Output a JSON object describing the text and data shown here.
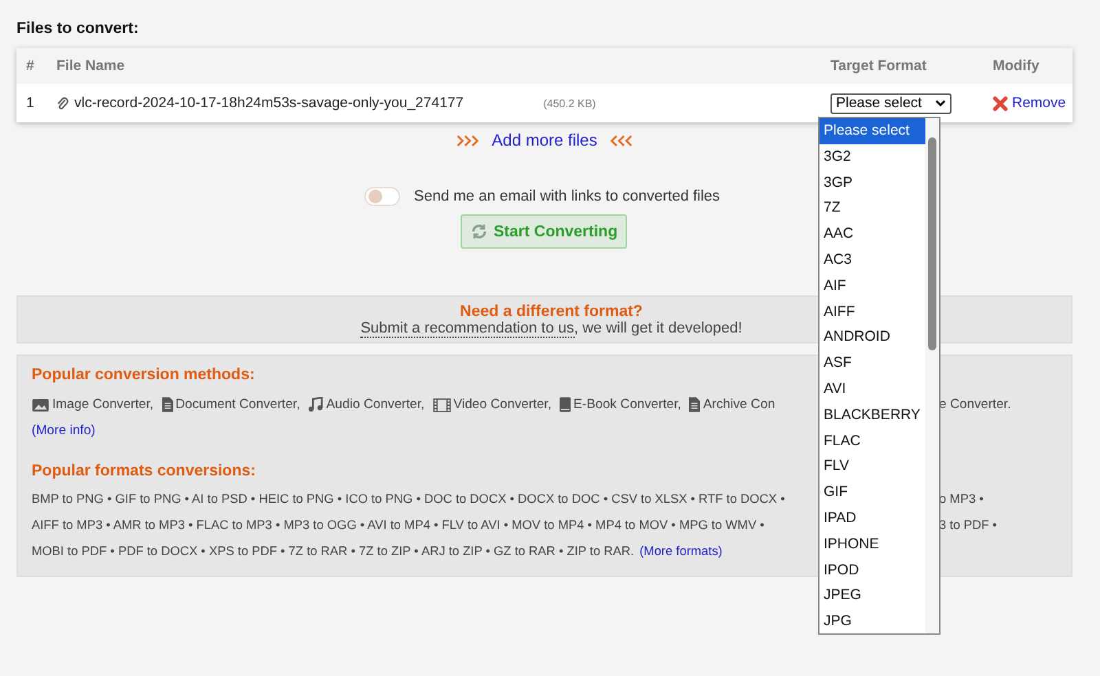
{
  "heading": "Files to convert:",
  "table": {
    "columns": [
      "#",
      "File Name",
      "Target Format",
      "Modify"
    ],
    "rows": [
      {
        "index": "1",
        "file_name": "vlc-record-2024-10-17-18h24m53s-savage-only-you_274177",
        "size": "(450.2 KB)",
        "target": "Please select",
        "remove": "Remove"
      }
    ]
  },
  "add_more": "Add more files",
  "email_toggle": {
    "on": false,
    "label": "Send me an email with links to converted files"
  },
  "convert_button": "Start Converting",
  "different_format": {
    "title": "Need a different format?",
    "link": "Submit a recommendation to us",
    "rest": ", we will get it developed!"
  },
  "methods": {
    "title": "Popular conversion methods:",
    "items": [
      {
        "kind": "image",
        "label": "Image Converter,"
      },
      {
        "kind": "document",
        "label": "Document Converter,"
      },
      {
        "kind": "audio",
        "label": "Audio Converter,"
      },
      {
        "kind": "video",
        "label": "Video Converter,"
      },
      {
        "kind": "ebook",
        "label": "E-Book Converter,"
      },
      {
        "kind": "document",
        "label": "Archive Con"
      }
    ],
    "after_dropdown": "e Converter.",
    "more": "(More info)"
  },
  "formats": {
    "title": "Popular formats conversions:",
    "lines": [
      {
        "left": "BMP to PNG • GIF to PNG • AI to PSD • HEIC to PNG • ICO to PNG • DOC to DOCX • DOCX to DOC • CSV to XLSX • RTF to DOCX •",
        "right": "o MP3 •"
      },
      {
        "left": "AIFF to MP3 • AMR to MP3 • FLAC to MP3 • MP3 to OGG • AVI to MP4 • FLV to AVI • MOV to MP4 • MP4 to MOV • MPG to WMV •",
        "right": "3 to PDF •"
      },
      {
        "left": "MOBI to PDF • PDF to DOCX • XPS to PDF • 7Z to RAR • 7Z to ZIP • ARJ to ZIP • GZ to RAR • ZIP to RAR.",
        "link": "(More formats)"
      }
    ]
  },
  "dropdown": {
    "options": [
      {
        "label": "Please select",
        "selected": true
      },
      {
        "label": "3G2",
        "selected": false
      },
      {
        "label": "3GP",
        "selected": false
      },
      {
        "label": "7Z",
        "selected": false
      },
      {
        "label": "AAC",
        "selected": false
      },
      {
        "label": "AC3",
        "selected": false
      },
      {
        "label": "AIF",
        "selected": false
      },
      {
        "label": "AIFF",
        "selected": false
      },
      {
        "label": "ANDROID",
        "selected": false
      },
      {
        "label": "ASF",
        "selected": false
      },
      {
        "label": "AVI",
        "selected": false
      },
      {
        "label": "BLACKBERRY",
        "selected": false
      },
      {
        "label": "FLAC",
        "selected": false
      },
      {
        "label": "FLV",
        "selected": false
      },
      {
        "label": "GIF",
        "selected": false
      },
      {
        "label": "IPAD",
        "selected": false
      },
      {
        "label": "IPHONE",
        "selected": false
      },
      {
        "label": "IPOD",
        "selected": false
      },
      {
        "label": "JPEG",
        "selected": false
      },
      {
        "label": "JPG",
        "selected": false
      }
    ]
  }
}
